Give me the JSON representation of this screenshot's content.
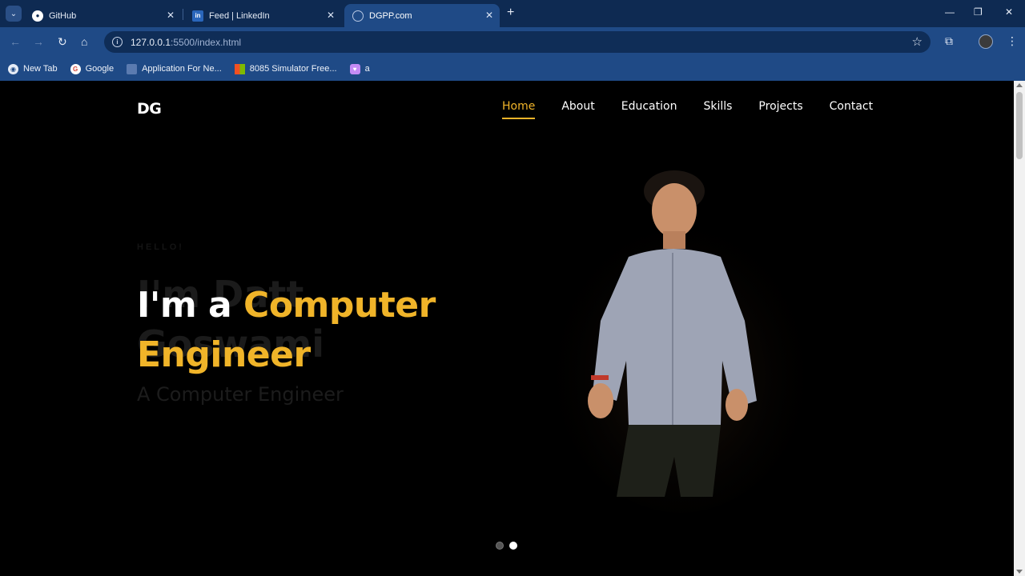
{
  "browser": {
    "tabs": [
      {
        "title": "GitHub",
        "icon": "github-icon"
      },
      {
        "title": "Feed | LinkedIn",
        "icon": "linkedin-icon"
      },
      {
        "title": "DGPP.com",
        "icon": "globe-icon",
        "active": true
      }
    ],
    "url_host": "127.0.0.1",
    "url_path": ":5500/index.html",
    "bookmarks": [
      {
        "label": "New Tab",
        "icon": "new-tab-icon"
      },
      {
        "label": "Google",
        "icon": "google-icon"
      },
      {
        "label": "Application For Ne...",
        "icon": "app-icon"
      },
      {
        "label": "8085 Simulator Free...",
        "icon": "microsoft-icon"
      },
      {
        "label": "a",
        "icon": "heart-icon"
      }
    ]
  },
  "site": {
    "logo": "DG",
    "nav": [
      {
        "label": "Home",
        "active": true
      },
      {
        "label": "About"
      },
      {
        "label": "Education"
      },
      {
        "label": "Skills"
      },
      {
        "label": "Projects"
      },
      {
        "label": "Contact"
      }
    ],
    "hero": {
      "greeting": "HELLO!",
      "ghost_name_line1": "I'm Datt",
      "ghost_name_line2": "Goswami",
      "headline_white": "I'm a ",
      "headline_gold_1": "Computer",
      "headline_gold_2": "Engineer",
      "subtitle": "A Computer Engineer"
    },
    "carousel": {
      "slides": 2,
      "current": 2
    }
  },
  "colors": {
    "accent": "#f0b429",
    "background": "#000000",
    "chrome_dark": "#0e2a52",
    "chrome": "#1f4a86"
  }
}
